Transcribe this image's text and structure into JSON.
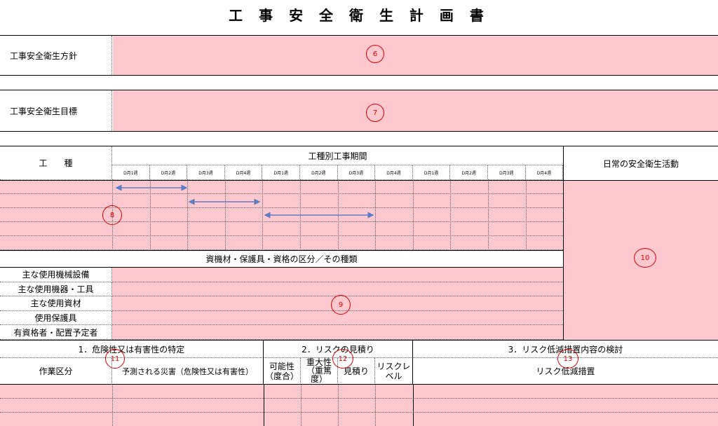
{
  "doc": {
    "title": "工 事 安 全 衛 生 計 画 書",
    "policy_label": "工事安全衛生方針",
    "goal_label": "工事安全衛生目標",
    "work_type_label": "工　　種",
    "period_label": "工種別工事期間",
    "daily_label": "日常の安全衛生活動",
    "weeks": [
      "D月1週",
      "D月2週",
      "D月3週",
      "D月4週",
      "D月1週",
      "D月2週",
      "D月3週",
      "D月4週",
      "D月1週",
      "D月2週",
      "D月3週",
      "D月4週"
    ],
    "materials_header": "資機材・保護具・資格の区分／その種類",
    "materials_rows": [
      "主な使用機械設備",
      "主な使用機器・工具",
      "主な使用資材",
      "使用保護具",
      "有資格者・配置予定者"
    ],
    "section1": "1．危険性又は有害性の特定",
    "section2": "2．リスクの見積り",
    "section3": "3．リスク低減措置内容の検討",
    "col_work": "作業区分",
    "col_hazard": "予測される災害（危険性又は有害性）",
    "col_likelihood": "可能性（度合）",
    "col_severity": "重大性（重篤度）",
    "col_estimate": "見積り",
    "col_level": "リスクレベル",
    "col_measures": "リスク低減措置"
  },
  "markers": {
    "m6": "6",
    "m7": "7",
    "m8": "8",
    "m9": "9",
    "m10": "10",
    "m11": "11",
    "m12": "12",
    "m13": "13"
  }
}
